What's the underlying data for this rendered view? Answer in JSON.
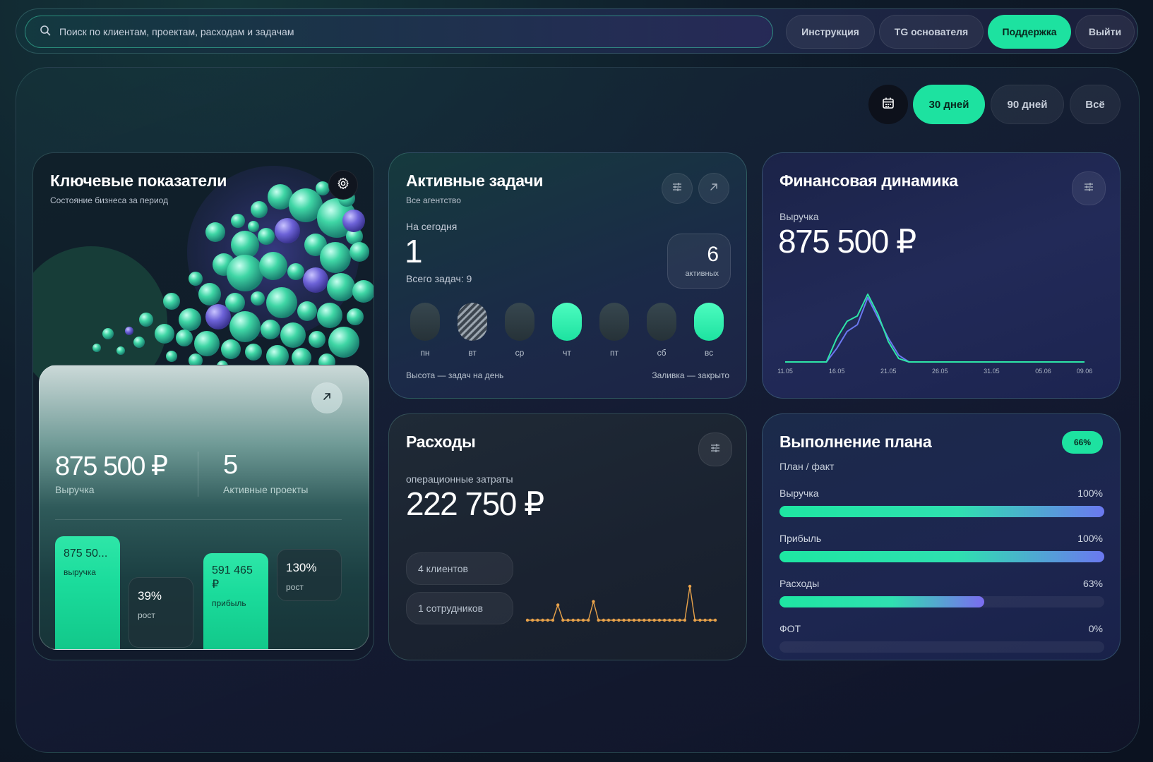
{
  "topbar": {
    "search_placeholder": "Поиск по клиентам, проектам, расходам и задачам",
    "buttons": {
      "instructions": "Инструкция",
      "founder_tg": "TG основателя",
      "support": "Поддержка",
      "logout": "Выйти"
    }
  },
  "range": {
    "d30": "30 дней",
    "d90": "90 дней",
    "all": "Всё",
    "selected": "30 дней"
  },
  "kpi": {
    "title": "Ключевые показатели",
    "subtitle": "Состояние бизнеса за период",
    "revenue_value": "875 500 ₽",
    "revenue_label": "Выручка",
    "projects_value": "5",
    "projects_label": "Активные проекты",
    "bars": [
      {
        "value": "875 50...",
        "label": "выручка"
      },
      {
        "value": "39%",
        "label": "рост"
      },
      {
        "value": "591 465 ₽",
        "label": "прибыль"
      },
      {
        "value": "130%",
        "label": "рост"
      }
    ]
  },
  "tasks": {
    "title": "Активные задачи",
    "subtitle": "Все агентство",
    "today_label": "На сегодня",
    "today_value": "1",
    "total_label": "Всего задач: 9",
    "active_value": "6",
    "active_label": "активных",
    "days": [
      {
        "label": "пн",
        "state": "empty"
      },
      {
        "label": "вт",
        "state": "hatched"
      },
      {
        "label": "ср",
        "state": "empty"
      },
      {
        "label": "чт",
        "state": "done"
      },
      {
        "label": "пт",
        "state": "empty"
      },
      {
        "label": "сб",
        "state": "empty"
      },
      {
        "label": "вс",
        "state": "done"
      }
    ],
    "legend_height": "Высота — задач на день",
    "legend_fill": "Заливка — закрыто"
  },
  "finance": {
    "title": "Финансовая динамика",
    "metric_label": "Выручка",
    "metric_value": "875 500 ₽"
  },
  "chart_data": [
    {
      "type": "line",
      "x": [
        "11.05",
        "12.05",
        "13.05",
        "14.05",
        "15.05",
        "16.05",
        "17.05",
        "18.05",
        "19.05",
        "20.05",
        "21.05",
        "22.05",
        "23.05",
        "24.05",
        "25.05",
        "26.05",
        "27.05",
        "28.05",
        "29.05",
        "30.05",
        "31.05",
        "01.06",
        "02.06",
        "03.06",
        "04.06",
        "05.06",
        "06.06",
        "07.06",
        "08.06",
        "09.06"
      ],
      "xticks": [
        "11.05",
        "16.05",
        "21.05",
        "26.05",
        "31.05",
        "05.06",
        "09.06"
      ],
      "series": [
        {
          "values": [
            0,
            0,
            0,
            0,
            0,
            0.35,
            0.6,
            0.68,
            1,
            0.7,
            0.3,
            0.05,
            0,
            0,
            0,
            0,
            0,
            0,
            0,
            0,
            0,
            0,
            0,
            0,
            0,
            0,
            0,
            0,
            0,
            0
          ],
          "color": "#2ee6a8"
        },
        {
          "values": [
            0,
            0,
            0,
            0,
            0,
            0.2,
            0.45,
            0.55,
            0.95,
            0.65,
            0.35,
            0.1,
            0,
            0,
            0,
            0,
            0,
            0,
            0,
            0,
            0,
            0,
            0,
            0,
            0,
            0,
            0,
            0,
            0,
            0
          ],
          "color": "#6b78f0"
        }
      ]
    },
    {
      "type": "line",
      "values": [
        0,
        0,
        0,
        0,
        0,
        0,
        0.45,
        0,
        0,
        0,
        0,
        0,
        0,
        0.55,
        0,
        0,
        0,
        0,
        0,
        0,
        0,
        0,
        0,
        0,
        0,
        0,
        0,
        0,
        0,
        0,
        0,
        0,
        1,
        0,
        0,
        0,
        0,
        0
      ],
      "color": "#e8a24a"
    }
  ],
  "expenses": {
    "title": "Расходы",
    "metric_label": "операционные затраты",
    "metric_value": "222 750 ₽",
    "chips": [
      "4 клиентов",
      "1 сотрудников"
    ]
  },
  "plan": {
    "title": "Выполнение плана",
    "subtitle": "План / факт",
    "badge": "66%",
    "rows": [
      {
        "label": "Выручка",
        "percent_text": "100%",
        "fraction": 1.0
      },
      {
        "label": "Прибыль",
        "percent_text": "100%",
        "fraction": 1.0
      },
      {
        "label": "Расходы",
        "percent_text": "63%",
        "fraction": 0.63
      },
      {
        "label": "ФОТ",
        "percent_text": "0%",
        "fraction": 0.0
      }
    ]
  }
}
